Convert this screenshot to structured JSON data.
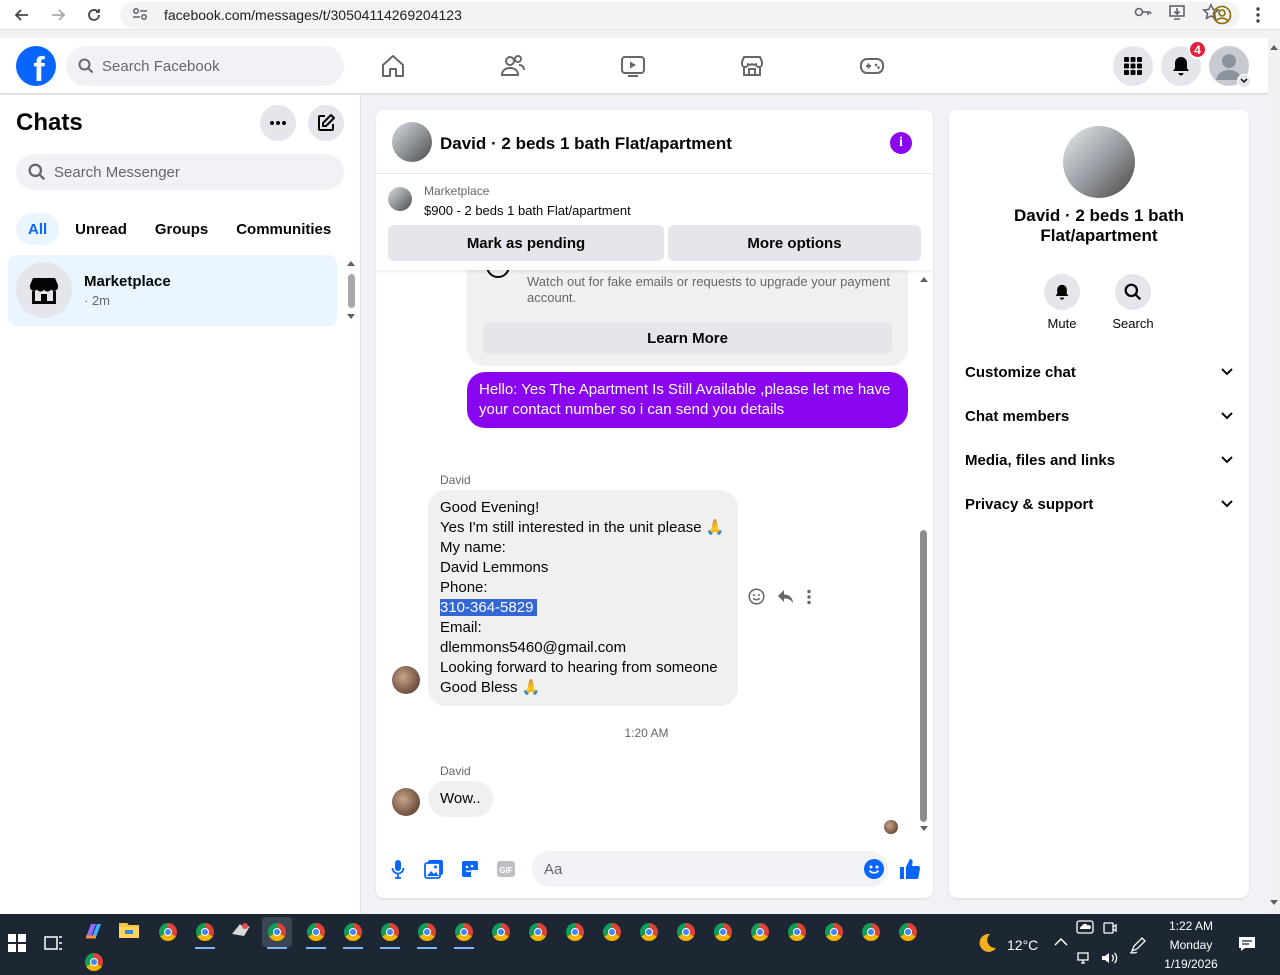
{
  "browser": {
    "url": "facebook.com/messages/t/30504114269204123"
  },
  "fb_nav": {
    "search_placeholder": "Search Facebook",
    "notifications_count": "4"
  },
  "chats": {
    "title": "Chats",
    "search_placeholder": "Search Messenger",
    "filters": [
      "All",
      "Unread",
      "Groups",
      "Communities"
    ],
    "active_filter": "All",
    "items": [
      {
        "name": "Marketplace",
        "time": "· 2m"
      }
    ]
  },
  "conversation": {
    "title": "David · 2 beds 1 bath Flat/apartment",
    "marketplace": {
      "label": "Marketplace",
      "listing": "$900 - 2 beds 1 bath Flat/apartment",
      "mark_pending": "Mark as pending",
      "more_options": "More options"
    },
    "warning": {
      "text": "Watch out for fake emails or requests to upgrade your payment account.",
      "learn_more": "Learn More"
    },
    "sent_message": "Hello: Yes The Apartment Is Still Available ,please let me have your contact number so i can send you details",
    "messages": [
      {
        "sender": "David",
        "lines": [
          "Good Evening!",
          "Yes I'm still interested in the unit please 🙏",
          "My name:",
          "David Lemmons",
          "Phone:",
          "310-364-5829",
          "Email:",
          "dlemmons5460@gmail.com",
          "Looking forward to hearing from someone",
          "Good Bless 🙏"
        ]
      },
      {
        "sender": "David",
        "lines": [
          "Wow.."
        ]
      }
    ],
    "timestamp": "1:20 AM",
    "composer_placeholder": "Aa"
  },
  "info_panel": {
    "title_line1": "David · 2 beds 1 bath",
    "title_line2": "Flat/apartment",
    "actions": [
      "Mute",
      "Search"
    ],
    "sections": [
      "Customize chat",
      "Chat members",
      "Media, files and links",
      "Privacy & support"
    ]
  },
  "taskbar": {
    "weather": "12°C",
    "time": "1:22 AM",
    "day": "Monday",
    "date": "1/19/2026"
  },
  "colors": {
    "facebook_blue": "#0866ff",
    "messenger_purple": "#8a06f0",
    "highlight": "#3367d6"
  }
}
